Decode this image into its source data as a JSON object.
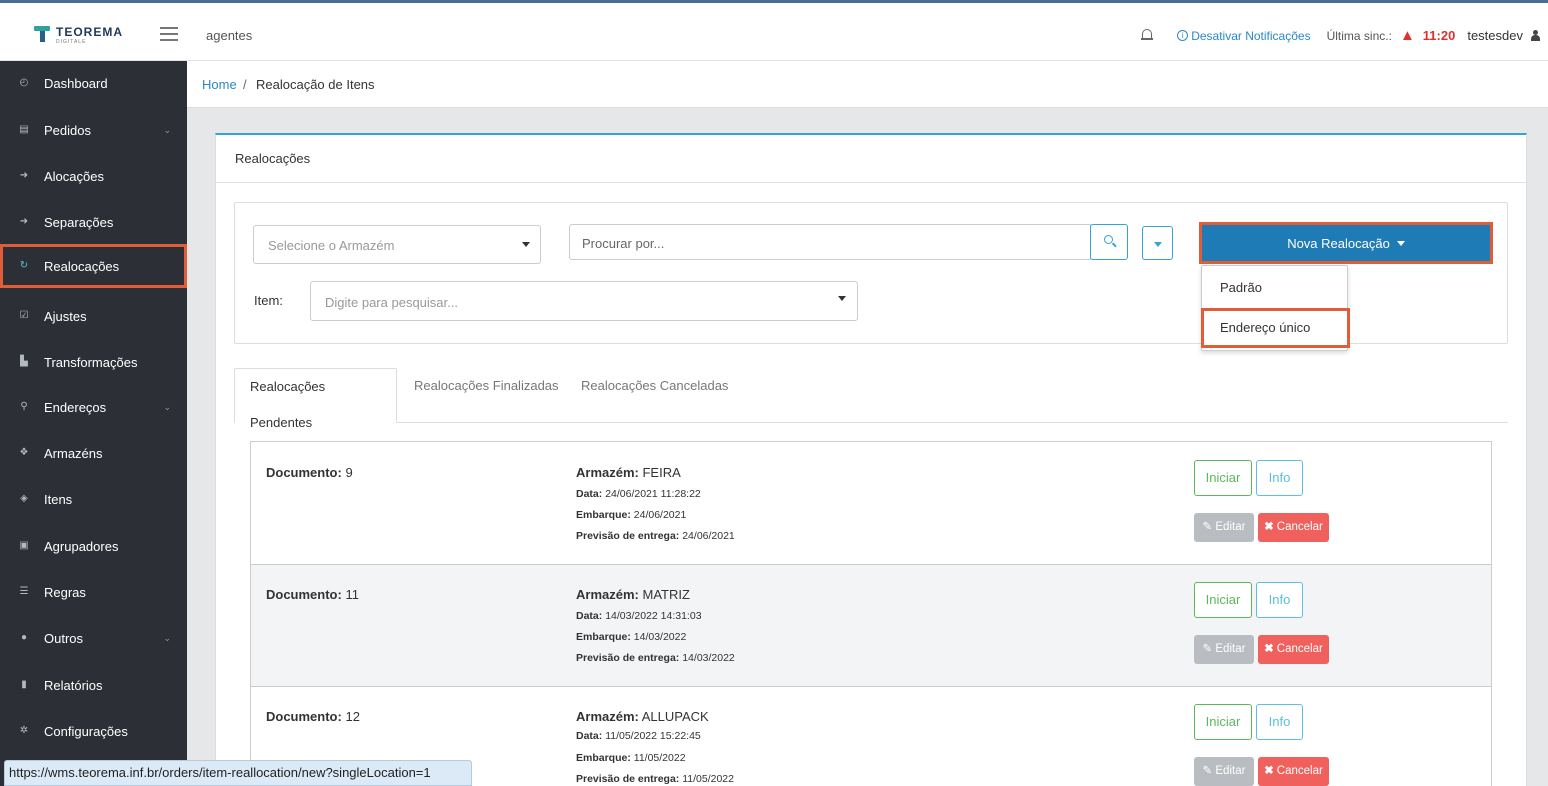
{
  "topbar": {
    "logo": "TEOREMA",
    "logo_sub": "DIGITALE",
    "agent": "agentes",
    "notif_label": "Desativar Notificações",
    "sync_label": "Última sinc.:",
    "sync_time": "11:20",
    "user": "testesdev"
  },
  "sidebar": {
    "items": [
      {
        "label": "Dashboard",
        "icon": "dashboard-icon"
      },
      {
        "label": "Pedidos",
        "icon": "orders-icon"
      },
      {
        "label": "Alocações",
        "icon": "sign-in-icon"
      },
      {
        "label": "Separações",
        "icon": "sign-out-icon"
      },
      {
        "label": "Realocações",
        "icon": "refresh-icon"
      },
      {
        "label": "Ajustes",
        "icon": "check-square-icon"
      },
      {
        "label": "Transformações",
        "icon": "bar-chart-icon"
      },
      {
        "label": "Endereços",
        "icon": "map-marker-icon"
      },
      {
        "label": "Armazéns",
        "icon": "cubes-icon"
      },
      {
        "label": "Itens",
        "icon": "cube-icon"
      },
      {
        "label": "Agrupadores",
        "icon": "object-group-icon"
      },
      {
        "label": "Regras",
        "icon": "list-icon"
      },
      {
        "label": "Outros",
        "icon": "info-circle-icon"
      },
      {
        "label": "Relatórios",
        "icon": "file-icon"
      },
      {
        "label": "Configurações",
        "icon": "cog-icon"
      }
    ]
  },
  "breadcrumb": {
    "home": "Home",
    "sep": "/",
    "current": "Realocação de Itens"
  },
  "card": {
    "title": "Realocações"
  },
  "filters": {
    "warehouse_placeholder": "Selecione o Armazém",
    "search_placeholder": "Procurar por...",
    "item_label": "Item:",
    "item_placeholder": "Digite para pesquisar..."
  },
  "nova": {
    "label": "Nova Realocação",
    "menu": [
      "Padrão",
      "Endereço único"
    ]
  },
  "tabs": [
    "Realocações Pendentes",
    "Realocações Finalizadas",
    "Realocações Canceladas"
  ],
  "labels": {
    "documento": "Documento:",
    "armazem": "Armazém:",
    "data": "Data:",
    "embarque": "Embarque:",
    "previsao": "Previsão de entrega:",
    "iniciar": "Iniciar",
    "info": "Info",
    "editar": "Editar",
    "cancelar": "Cancelar"
  },
  "rows": [
    {
      "doc": "9",
      "armazem": "FEIRA",
      "data": "24/06/2021 11:28:22",
      "embarque": "24/06/2021",
      "previsao": "24/06/2021"
    },
    {
      "doc": "11",
      "armazem": "MATRIZ",
      "data": "14/03/2022 14:31:03",
      "embarque": "14/03/2022",
      "previsao": "14/03/2022"
    },
    {
      "doc": "12",
      "armazem": "ALLUPACK",
      "data": "11/05/2022 15:22:45",
      "embarque": "11/05/2022",
      "previsao": "11/05/2022"
    }
  ],
  "statusbar": {
    "url": "https://wms.teorema.inf.br/orders/item-reallocation/new?singleLocation=1"
  },
  "colors": {
    "accent": "#1f7bb5",
    "highlight": "#e05e37",
    "sidebar": "#2c2f36"
  }
}
